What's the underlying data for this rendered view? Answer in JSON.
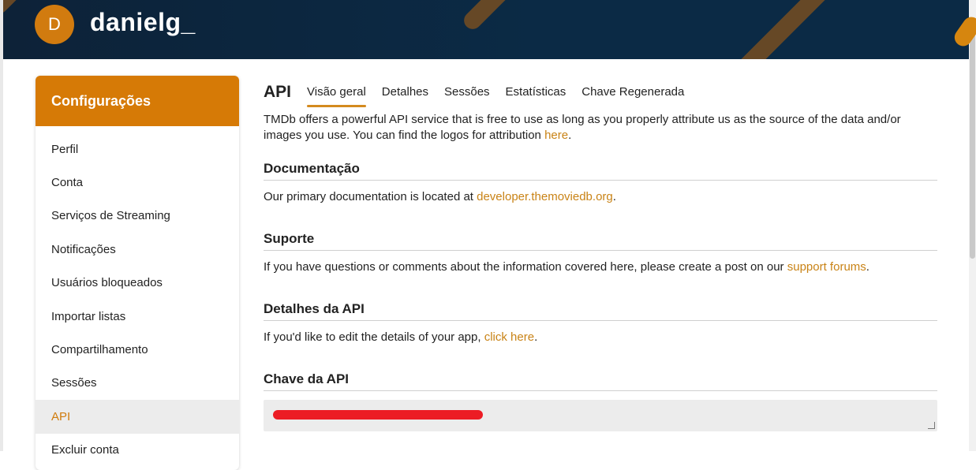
{
  "profile": {
    "avatar_letter": "D",
    "username": "danielg_"
  },
  "colors": {
    "accent": "#d67a06",
    "link": "#c98316",
    "header_bg": "#0b2a45",
    "active_bg": "#ececec"
  },
  "sidebar": {
    "title": "Configurações",
    "items": [
      {
        "label": "Perfil"
      },
      {
        "label": "Conta"
      },
      {
        "label": "Serviços de Streaming"
      },
      {
        "label": "Notificações"
      },
      {
        "label": "Usuários bloqueados"
      },
      {
        "label": "Importar listas"
      },
      {
        "label": "Compartilhamento"
      },
      {
        "label": "Sessões"
      },
      {
        "label": "API",
        "active": true
      },
      {
        "label": "Excluir conta"
      }
    ]
  },
  "main": {
    "title": "API",
    "tabs": [
      {
        "label": "Visão geral",
        "active": true
      },
      {
        "label": "Detalhes"
      },
      {
        "label": "Sessões"
      },
      {
        "label": "Estatísticas"
      },
      {
        "label": "Chave Regenerada"
      }
    ],
    "intro_text": "TMDb offers a powerful API service that is free to use as long as you properly attribute us as the source of the data and/or images you use. You can find the logos for attribution ",
    "intro_link": "here",
    "intro_end": ".",
    "sections": {
      "docs": {
        "title": "Documentação",
        "text": "Our primary documentation is located at ",
        "link": "developer.themoviedb.org",
        "end": "."
      },
      "support": {
        "title": "Suporte",
        "text": "If you have questions or comments about the information covered here, please create a post on our ",
        "link": "support forums",
        "end": "."
      },
      "details": {
        "title": "Detalhes da API",
        "text": "If you'd like to edit the details of your app, ",
        "link": "click here",
        "end": "."
      },
      "key": {
        "title": "Chave da API"
      }
    }
  }
}
